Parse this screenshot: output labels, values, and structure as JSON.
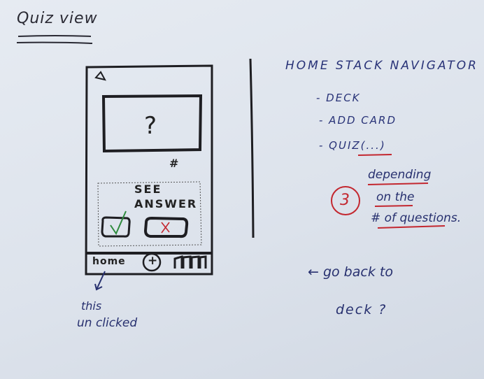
{
  "title": "Quiz view",
  "phone": {
    "back_icon": "back-arrow-icon",
    "question_mark": "?",
    "hash": "#",
    "see_answer_line1": "SEE",
    "see_answer_line2": "ANSWER",
    "correct_icon": "check-icon",
    "incorrect_icon": "x-icon",
    "tabbar": {
      "home": "home",
      "add": "+",
      "decks_icon": "deck-stack-icon"
    }
  },
  "annotation_bottom": {
    "line1": "this",
    "line2": "un clicked"
  },
  "navigator": {
    "header": "HOME STACK NAVIGATOR",
    "items": [
      "- DECK",
      "- ADD CARD",
      "- QUIZ(...)"
    ],
    "note_number": "3",
    "note_lines": [
      "depending",
      "on the",
      "# of questions."
    ]
  },
  "bottom_note": {
    "line1": "← go back to",
    "line2": "deck ?"
  },
  "colors": {
    "ink_black": "#222222",
    "ink_blue": "#283277",
    "ink_red": "#c3272f",
    "ink_green": "#2e8b3e"
  }
}
